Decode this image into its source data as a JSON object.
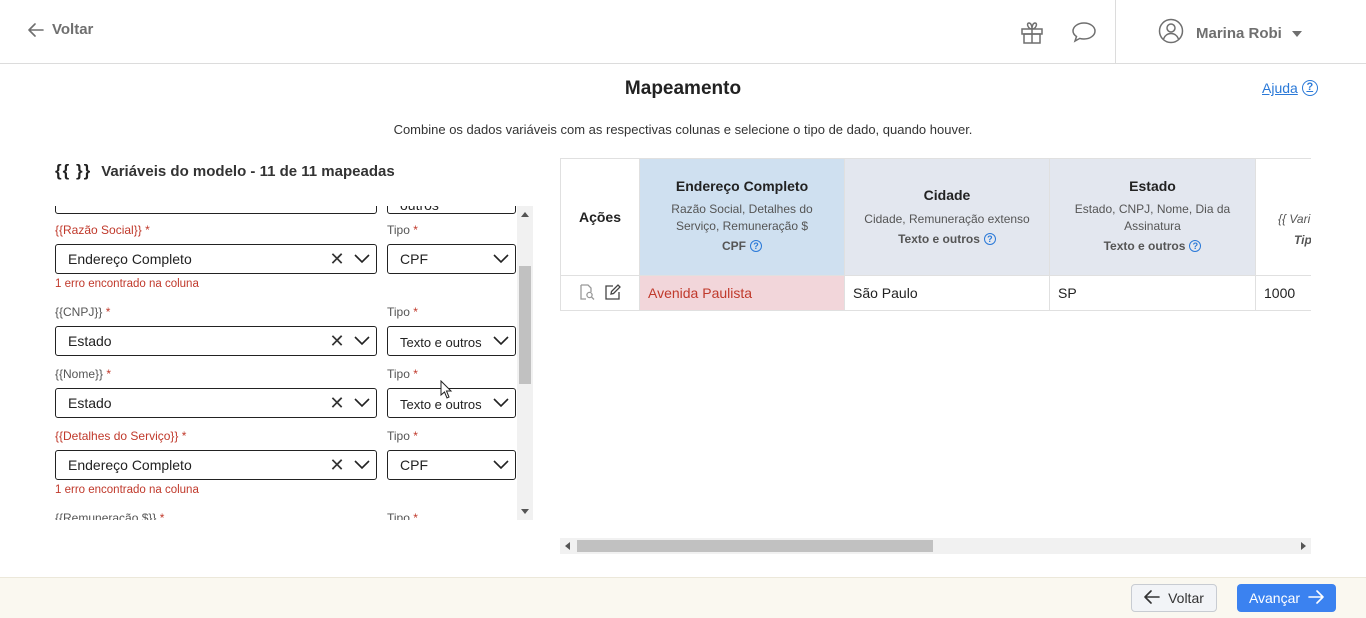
{
  "header": {
    "back_label": "Voltar",
    "user_name": "Marina Robi",
    "icons": [
      "gift-icon",
      "chat-icon",
      "user-avatar-icon",
      "chevron-down-icon"
    ]
  },
  "page": {
    "title": "Mapeamento",
    "help_label": "Ajuda",
    "help_glyph": "?",
    "subtitle": "Combine os dados variáveis com as respectivas colunas e selecione o tipo de dado, quando houver."
  },
  "variables": {
    "icon_text": "{{ }}",
    "title": "Variáveis do modelo - 11 de 11 mapeadas",
    "type_label": "Tipo",
    "required_mark": "*",
    "partial_top": {
      "value": "",
      "type": "outros"
    },
    "items": [
      {
        "label": "{{Razão Social}}",
        "column": "Endereço Completo",
        "type": "CPF",
        "error": "1 erro encontrado na coluna"
      },
      {
        "label": "{{CNPJ}}",
        "column": "Estado",
        "type": "Texto e outros",
        "error": ""
      },
      {
        "label": "{{Nome}}",
        "column": "Estado",
        "type": "Texto e outros",
        "error": ""
      },
      {
        "label": "{{Detalhes do Serviço}}",
        "column": "Endereço Completo",
        "type": "CPF",
        "error": "1 erro encontrado na coluna"
      },
      {
        "label": "{{Remuneração $}}",
        "column": "",
        "type": "",
        "error": ""
      }
    ]
  },
  "table": {
    "actions_header": "Ações",
    "columns": [
      {
        "title": "Endereço Completo",
        "vars": "Razão Social, Detalhes do Serviço, Remuneração $",
        "type": "CPF",
        "value": "Avenida Paulista",
        "status": "error"
      },
      {
        "title": "Cidade",
        "vars": "Cidade, Remuneração extenso",
        "type": "Texto e outros",
        "value": "São Paulo",
        "status": "ok"
      },
      {
        "title": "Estado",
        "vars": "Estado, CNPJ, Nome, Dia da Assinatura",
        "type": "Texto e outros",
        "value": "SP",
        "status": "ok"
      },
      {
        "title": "",
        "vars": "{{ Vari",
        "type": "Tip",
        "value": "1000",
        "status": "none"
      }
    ]
  },
  "colors": {
    "accent": "#3b82f0",
    "error": "#c0392b",
    "col1_header_bg": "#cfe0f0",
    "col_header_bg": "#e3e7ef",
    "error_cell_bg": "#f2d6da"
  },
  "footer": {
    "back_label": "Voltar",
    "next_label": "Avançar"
  }
}
